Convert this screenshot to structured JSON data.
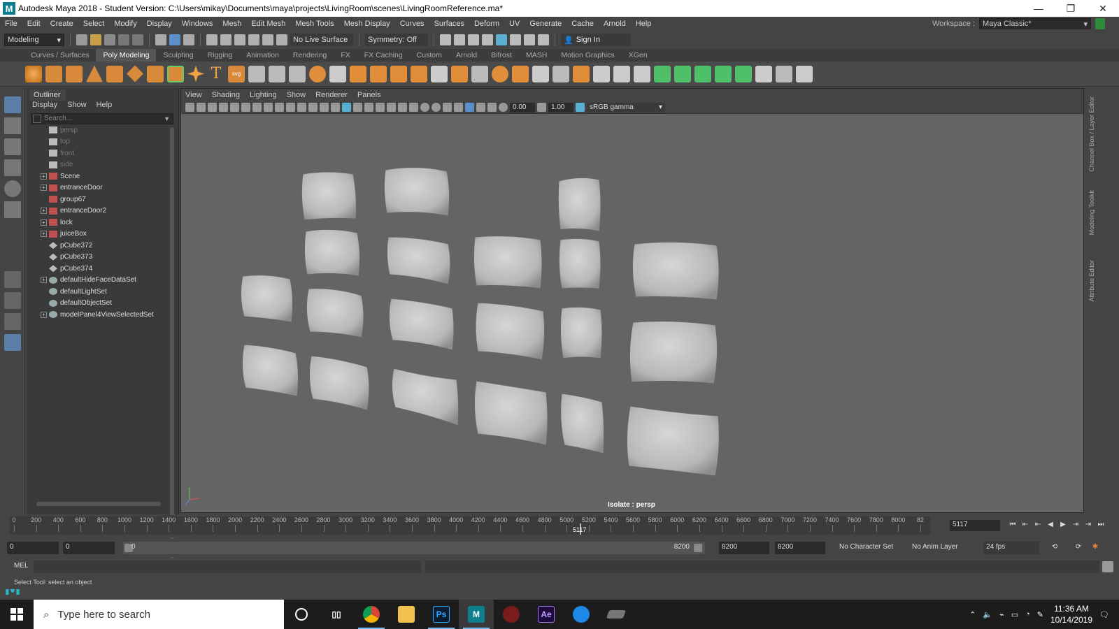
{
  "window": {
    "title": "Autodesk Maya 2018 - Student Version: C:\\Users\\mikay\\Documents\\maya\\projects\\LivingRoom\\scenes\\LivingRoomReference.ma*",
    "logo": "M"
  },
  "menubar": {
    "items": [
      "File",
      "Edit",
      "Create",
      "Select",
      "Modify",
      "Display",
      "Windows",
      "Mesh",
      "Edit Mesh",
      "Mesh Tools",
      "Mesh Display",
      "Curves",
      "Surfaces",
      "Deform",
      "UV",
      "Generate",
      "Cache",
      "Arnold",
      "Help"
    ],
    "workspace_label": "Workspace :",
    "workspace_value": "Maya Classic*"
  },
  "statusline": {
    "mode": "Modeling",
    "live_surface": "No Live Surface",
    "symmetry": "Symmetry: Off",
    "sign_in": "Sign In"
  },
  "shelf": {
    "tabs": [
      "Curves / Surfaces",
      "Poly Modeling",
      "Sculpting",
      "Rigging",
      "Animation",
      "Rendering",
      "FX",
      "FX Caching",
      "Custom",
      "Arnold",
      "Bifrost",
      "MASH",
      "Motion Graphics",
      "XGen"
    ],
    "active_tab": "Poly Modeling"
  },
  "outliner": {
    "tab": "Outliner",
    "menu": [
      "Display",
      "Show",
      "Help"
    ],
    "search_placeholder": "Search...",
    "items": [
      {
        "label": "persp",
        "type": "camera",
        "expandable": false,
        "dim": true
      },
      {
        "label": "top",
        "type": "camera",
        "expandable": false,
        "dim": true
      },
      {
        "label": "front",
        "type": "camera",
        "expandable": false,
        "dim": true
      },
      {
        "label": "side",
        "type": "camera",
        "expandable": false,
        "dim": true
      },
      {
        "label": "Scene",
        "type": "group",
        "expandable": true,
        "dim": false
      },
      {
        "label": "entranceDoor",
        "type": "group",
        "expandable": true,
        "dim": false
      },
      {
        "label": "group67",
        "type": "group",
        "expandable": false,
        "dim": false
      },
      {
        "label": "entranceDoor2",
        "type": "group",
        "expandable": true,
        "dim": false
      },
      {
        "label": "lock",
        "type": "group",
        "expandable": true,
        "dim": false
      },
      {
        "label": "juiceBox",
        "type": "group",
        "expandable": true,
        "dim": false
      },
      {
        "label": "pCube372",
        "type": "mesh",
        "expandable": false,
        "dim": false
      },
      {
        "label": "pCube373",
        "type": "mesh",
        "expandable": false,
        "dim": false
      },
      {
        "label": "pCube374",
        "type": "mesh",
        "expandable": false,
        "dim": false
      },
      {
        "label": "defaultHideFaceDataSet",
        "type": "set",
        "expandable": true,
        "dim": false
      },
      {
        "label": "defaultLightSet",
        "type": "set",
        "expandable": false,
        "dim": false
      },
      {
        "label": "defaultObjectSet",
        "type": "set",
        "expandable": false,
        "dim": false
      },
      {
        "label": "modelPanel4ViewSelectedSet",
        "type": "set",
        "expandable": true,
        "dim": false
      }
    ]
  },
  "viewport": {
    "menu": [
      "View",
      "Shading",
      "Lighting",
      "Show",
      "Renderer",
      "Panels"
    ],
    "exposure": "0.00",
    "gamma": "1.00",
    "color_space": "sRGB gamma",
    "isolate_label": "Isolate : persp",
    "pillow_count": 20
  },
  "timeslider": {
    "ticks": [
      "0",
      "200",
      "400",
      "600",
      "800",
      "1000",
      "1200",
      "1400",
      "1600",
      "1800",
      "2000",
      "2200",
      "2400",
      "2600",
      "2800",
      "3000",
      "3200",
      "3400",
      "3600",
      "3800",
      "4000",
      "4200",
      "4400",
      "4600",
      "4800",
      "5000",
      "5200",
      "5400",
      "5600",
      "5800",
      "6000",
      "6200",
      "6400",
      "6600",
      "6800",
      "7000",
      "7200",
      "7400",
      "7600",
      "7800",
      "8000",
      "82"
    ],
    "current_frame": "5117",
    "current_frame_value": 5117,
    "max_frame": 8200
  },
  "rangebar": {
    "start": "0",
    "anim_start": "0",
    "slider_start": "0",
    "slider_end": "8200",
    "playback_end": "8200",
    "anim_end": "8200",
    "character_set": "No Character Set",
    "anim_layer": "No Anim Layer",
    "fps": "24 fps"
  },
  "mel": {
    "label": "MEL",
    "help_text": "Select Tool: select an object"
  },
  "taskbar": {
    "search_placeholder": "Type here to search",
    "apps": [
      "cortana",
      "task-view",
      "chrome",
      "file-explorer",
      "photoshop",
      "maya",
      "mudbox",
      "after-effects",
      "unknown-app",
      "generic-app"
    ],
    "time": "11:36 AM",
    "date": "10/14/2019"
  }
}
